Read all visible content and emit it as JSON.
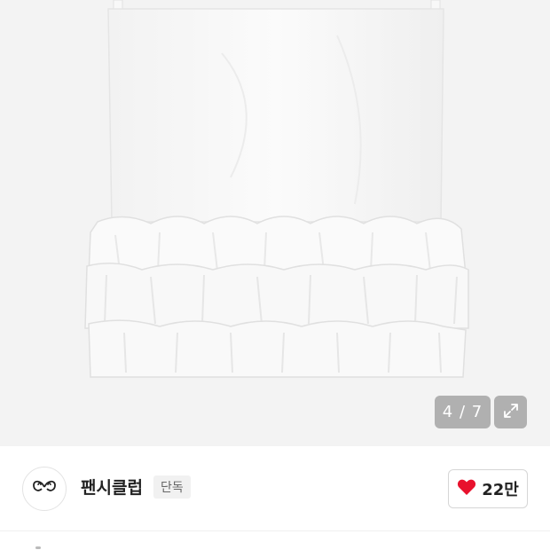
{
  "gallery": {
    "image_alt": "white sleeveless top with ruffled hem",
    "counter": "4 / 7",
    "current": 4,
    "total": 7
  },
  "store": {
    "name": "팬시클럽",
    "badge": "단독",
    "logo_icon": "bow-logo-icon"
  },
  "like": {
    "icon": "heart-icon",
    "count": "22만",
    "color": "#e8112d"
  }
}
